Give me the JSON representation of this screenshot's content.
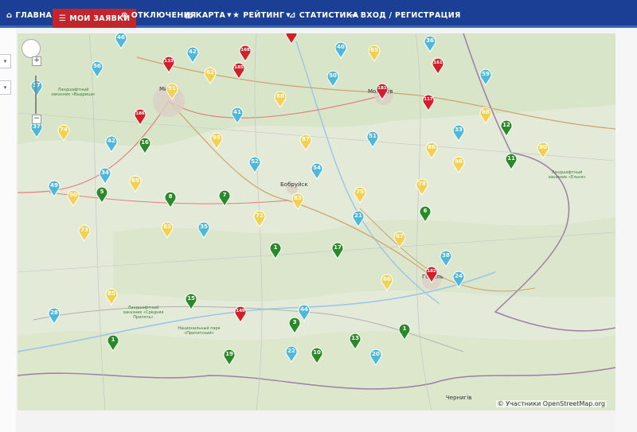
{
  "nav": {
    "home": {
      "label": "ГЛАВНАЯ",
      "icon": "home-icon"
    },
    "my_requests": {
      "label": "МОИ ЗАЯВКИ",
      "icon": "list-icon"
    },
    "outages": {
      "label": "ОТКЛЮЧЕНИЯ",
      "icon": "outage-icon"
    },
    "map": {
      "label": "КАРТА",
      "icon": "map-icon"
    },
    "rating": {
      "label": "РЕЙТИНГ",
      "icon": "star-icon"
    },
    "stats": {
      "label": "СТАТИСТИКА",
      "icon": "chart-icon"
    },
    "login": {
      "label": "ВХОД / РЕГИСТРАЦИЯ",
      "icon": "login-icon"
    }
  },
  "colors": {
    "nav_bg": "#1c3f96",
    "active": "#c0262c",
    "red": "#d0202a",
    "blue": "#4fb8d8",
    "yellow": "#f2d052",
    "green": "#2a8a2a"
  },
  "map": {
    "attribution": "© Участники OpenStreetMap.org",
    "towns": [
      "Минск",
      "Могилёв",
      "Бобруйск",
      "Гомель",
      "Чернигів"
    ],
    "parks": [
      "Ландшафтный заказник «Выдрица»",
      "Ландшафтный заказник «Средняя Припять»",
      "Национальный парк «Припятский»",
      "Ландшафтный заказник «Ельня»"
    ],
    "markers": [
      {
        "n": "46",
        "c": "blue"
      },
      {
        "n": "42",
        "c": "blue"
      },
      {
        "n": "56",
        "c": "blue"
      },
      {
        "n": "133",
        "c": "red"
      },
      {
        "n": "185",
        "c": "red"
      },
      {
        "n": "168",
        "c": "red"
      },
      {
        "n": "167",
        "c": "red"
      },
      {
        "n": "40",
        "c": "blue"
      },
      {
        "n": "65",
        "c": "yellow"
      },
      {
        "n": "36",
        "c": "blue"
      },
      {
        "n": "161",
        "c": "red"
      },
      {
        "n": "59",
        "c": "blue"
      },
      {
        "n": "62",
        "c": "yellow"
      },
      {
        "n": "91",
        "c": "yellow"
      },
      {
        "n": "37",
        "c": "blue"
      },
      {
        "n": "50",
        "c": "blue"
      },
      {
        "n": "181",
        "c": "red"
      },
      {
        "n": "117",
        "c": "red"
      },
      {
        "n": "68",
        "c": "yellow"
      },
      {
        "n": "186",
        "c": "red"
      },
      {
        "n": "41",
        "c": "blue"
      },
      {
        "n": "88",
        "c": "yellow"
      },
      {
        "n": "12",
        "c": "green"
      },
      {
        "n": "37",
        "c": "blue"
      },
      {
        "n": "74",
        "c": "yellow"
      },
      {
        "n": "33",
        "c": "blue"
      },
      {
        "n": "42",
        "c": "blue"
      },
      {
        "n": "16",
        "c": "green"
      },
      {
        "n": "95",
        "c": "yellow"
      },
      {
        "n": "87",
        "c": "yellow"
      },
      {
        "n": "51",
        "c": "blue"
      },
      {
        "n": "86",
        "c": "yellow"
      },
      {
        "n": "80",
        "c": "yellow"
      },
      {
        "n": "11",
        "c": "green"
      },
      {
        "n": "52",
        "c": "blue"
      },
      {
        "n": "96",
        "c": "yellow"
      },
      {
        "n": "34",
        "c": "blue"
      },
      {
        "n": "54",
        "c": "blue"
      },
      {
        "n": "49",
        "c": "blue"
      },
      {
        "n": "69",
        "c": "yellow"
      },
      {
        "n": "78",
        "c": "yellow"
      },
      {
        "n": "90",
        "c": "yellow"
      },
      {
        "n": "5",
        "c": "green"
      },
      {
        "n": "8",
        "c": "green"
      },
      {
        "n": "7",
        "c": "green"
      },
      {
        "n": "83",
        "c": "yellow"
      },
      {
        "n": "75",
        "c": "yellow"
      },
      {
        "n": "21",
        "c": "blue"
      },
      {
        "n": "6",
        "c": "green"
      },
      {
        "n": "72",
        "c": "yellow"
      },
      {
        "n": "73",
        "c": "yellow"
      },
      {
        "n": "83",
        "c": "yellow"
      },
      {
        "n": "35",
        "c": "blue"
      },
      {
        "n": "67",
        "c": "yellow"
      },
      {
        "n": "1",
        "c": "green"
      },
      {
        "n": "17",
        "c": "green"
      },
      {
        "n": "38",
        "c": "blue"
      },
      {
        "n": "182",
        "c": "red"
      },
      {
        "n": "24",
        "c": "blue"
      },
      {
        "n": "66",
        "c": "yellow"
      },
      {
        "n": "85",
        "c": "yellow"
      },
      {
        "n": "15",
        "c": "green"
      },
      {
        "n": "149",
        "c": "red"
      },
      {
        "n": "44",
        "c": "blue"
      },
      {
        "n": "28",
        "c": "blue"
      },
      {
        "n": "3",
        "c": "green"
      },
      {
        "n": "1",
        "c": "green"
      },
      {
        "n": "13",
        "c": "green"
      },
      {
        "n": "1",
        "c": "green"
      },
      {
        "n": "22",
        "c": "blue"
      },
      {
        "n": "10",
        "c": "green"
      },
      {
        "n": "20",
        "c": "blue"
      },
      {
        "n": "19",
        "c": "green"
      }
    ]
  }
}
